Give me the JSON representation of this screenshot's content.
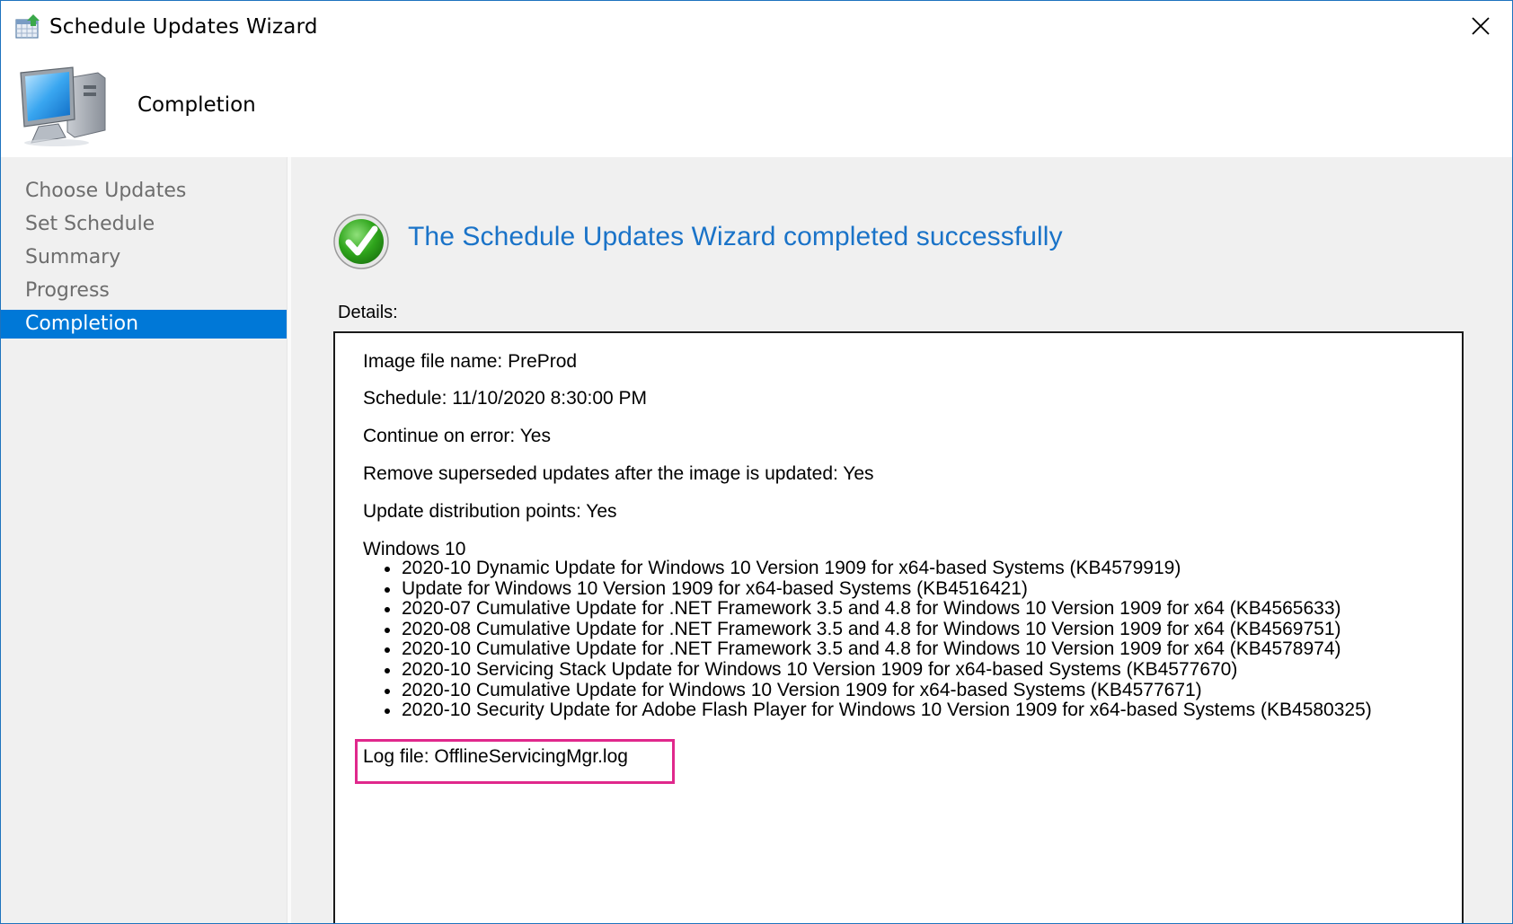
{
  "window": {
    "title": "Schedule Updates Wizard"
  },
  "header": {
    "page_title": "Completion"
  },
  "sidebar": {
    "items": [
      {
        "label": "Choose Updates",
        "active": false
      },
      {
        "label": "Set Schedule",
        "active": false
      },
      {
        "label": "Summary",
        "active": false
      },
      {
        "label": "Progress",
        "active": false
      },
      {
        "label": "Completion",
        "active": true
      }
    ]
  },
  "main": {
    "success_message": "The Schedule Updates Wizard completed successfully",
    "details_label": "Details:",
    "details": {
      "image_file_name": "Image file name: PreProd",
      "schedule": "Schedule: 11/10/2020 8:30:00 PM",
      "continue_on_error": "Continue on error: Yes",
      "remove_superseded": "Remove superseded updates after the image is updated: Yes",
      "update_distribution_points": "Update distribution points: Yes",
      "os_heading": "Windows 10",
      "updates": [
        "2020-10 Dynamic Update for Windows 10 Version 1909 for x64-based Systems (KB4579919)",
        "Update for Windows 10 Version 1909 for x64-based Systems (KB4516421)",
        "2020-07 Cumulative Update for .NET Framework 3.5 and 4.8 for Windows 10 Version 1909 for x64 (KB4565633)",
        "2020-08 Cumulative Update for .NET Framework 3.5 and 4.8 for Windows 10 Version 1909 for x64 (KB4569751)",
        "2020-10 Cumulative Update for .NET Framework 3.5 and 4.8 for Windows 10 Version 1909 for x64 (KB4578974)",
        "2020-10 Servicing Stack Update for Windows 10 Version 1909 for x64-based Systems (KB4577670)",
        "2020-10 Cumulative Update for Windows 10 Version 1909 for x64-based Systems (KB4577671)",
        "2020-10 Security Update for Adobe Flash Player for Windows 10 Version 1909 for x64-based Systems (KB4580325)"
      ],
      "log_file": "Log file: OfflineServicingMgr.log"
    }
  },
  "colors": {
    "accent": "#0078d7",
    "success_text": "#1a73c8",
    "highlight_border": "#e0288c",
    "window_border": "#1e73be"
  },
  "icons": {
    "title": "schedule-calendar-icon",
    "header": "computer-monitor-icon",
    "success": "green-checkmark-icon",
    "close": "close-icon"
  }
}
